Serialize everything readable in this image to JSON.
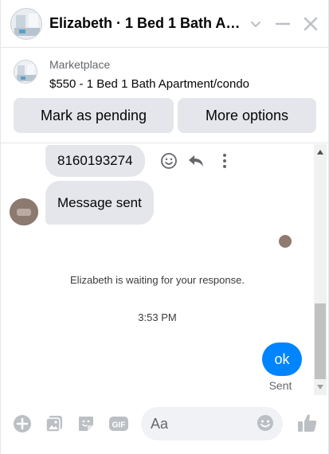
{
  "header": {
    "title": "Elizabeth · 1 Bed 1 Bath Ap...",
    "avatar_icon": "listing-photo-icon",
    "icons": [
      "chevron-down-icon",
      "minimize-icon",
      "close-icon"
    ]
  },
  "marketplace": {
    "source_label": "Marketplace",
    "listing": "$550 - 1 Bed 1 Bath Apartment/condo",
    "primary_action": "Mark as pending",
    "secondary_action": "More options"
  },
  "conversation": {
    "messages": [
      {
        "from": "Elizabeth",
        "text": "8160193274"
      },
      {
        "from": "Elizabeth",
        "text": "Message sent"
      }
    ],
    "system_note": "Elizabeth is waiting for your response.",
    "timestamp": "3:53 PM",
    "outgoing": {
      "text": "ok",
      "status": "Sent"
    }
  },
  "composer": {
    "placeholder": "Aa",
    "icons": [
      "add-icon",
      "photo-icon",
      "sticker-icon",
      "gif-icon",
      "emoji-icon",
      "like-icon"
    ]
  },
  "colors": {
    "accent": "#0084ff",
    "bubble_incoming": "#e4e6eb",
    "icon_gray": "#bcc0c4",
    "button_bg": "#e4e6eb"
  }
}
